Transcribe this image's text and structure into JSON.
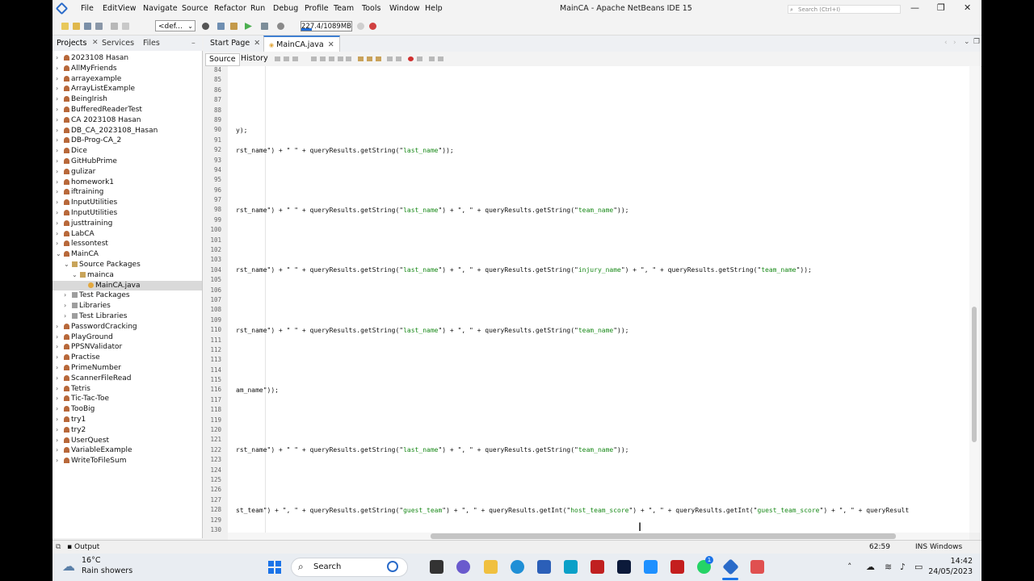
{
  "window": {
    "title": "MainCA - Apache NetBeans IDE 15",
    "search_placeholder": "Search (Ctrl+I)"
  },
  "menu": [
    "File",
    "Edit",
    "View",
    "Navigate",
    "Source",
    "Refactor",
    "Run",
    "Debug",
    "Profile",
    "Team",
    "Tools",
    "Window",
    "Help"
  ],
  "toolbar": {
    "config": "<def...",
    "memory": "227.4/1089MB",
    "memory_fraction": 0.209
  },
  "projects_panel": {
    "tabs": [
      "Projects",
      "Services",
      "Files"
    ],
    "items": [
      {
        "label": "2023108 Hasan",
        "depth": 0,
        "icon": "project-icon"
      },
      {
        "label": "AllMyFriends",
        "depth": 0,
        "icon": "project-icon"
      },
      {
        "label": "arrayexample",
        "depth": 0,
        "icon": "project-icon"
      },
      {
        "label": "ArrayListExample",
        "depth": 0,
        "icon": "project-icon"
      },
      {
        "label": "BeingIrish",
        "depth": 0,
        "icon": "project-icon"
      },
      {
        "label": "BufferedReaderTest",
        "depth": 0,
        "icon": "project-icon"
      },
      {
        "label": "CA 2023108 Hasan",
        "depth": 0,
        "icon": "project-icon"
      },
      {
        "label": "DB_CA_2023108_Hasan",
        "depth": 0,
        "icon": "project-icon"
      },
      {
        "label": "DB-Prog-CA_2",
        "depth": 0,
        "icon": "project-icon"
      },
      {
        "label": "Dice",
        "depth": 0,
        "icon": "project-icon"
      },
      {
        "label": "GitHubPrime",
        "depth": 0,
        "icon": "project-icon"
      },
      {
        "label": "gulizar",
        "depth": 0,
        "icon": "project-icon"
      },
      {
        "label": "homework1",
        "depth": 0,
        "icon": "project-icon"
      },
      {
        "label": "iftraining",
        "depth": 0,
        "icon": "project-icon"
      },
      {
        "label": "InputUtilities",
        "depth": 0,
        "icon": "project-icon"
      },
      {
        "label": "InputUtilities",
        "depth": 0,
        "icon": "project-icon"
      },
      {
        "label": "justtraining",
        "depth": 0,
        "icon": "project-icon"
      },
      {
        "label": "LabCA",
        "depth": 0,
        "icon": "project-icon"
      },
      {
        "label": "lessontest",
        "depth": 0,
        "icon": "project-icon"
      },
      {
        "label": "MainCA",
        "depth": 0,
        "icon": "project-icon",
        "expanded": true
      },
      {
        "label": "Source Packages",
        "depth": 1,
        "icon": "source-packages-icon",
        "expanded": true
      },
      {
        "label": "mainca",
        "depth": 2,
        "icon": "package-icon",
        "expanded": true
      },
      {
        "label": "MainCA.java",
        "depth": 3,
        "icon": "java-file-icon",
        "selected": true
      },
      {
        "label": "Test Packages",
        "depth": 1,
        "icon": "folder-icon"
      },
      {
        "label": "Libraries",
        "depth": 1,
        "icon": "folder-icon"
      },
      {
        "label": "Test Libraries",
        "depth": 1,
        "icon": "folder-icon"
      },
      {
        "label": "PasswordCracking",
        "depth": 0,
        "icon": "project-icon"
      },
      {
        "label": "PlayGround",
        "depth": 0,
        "icon": "project-icon"
      },
      {
        "label": "PPSNValidator",
        "depth": 0,
        "icon": "project-icon"
      },
      {
        "label": "Practise",
        "depth": 0,
        "icon": "project-icon"
      },
      {
        "label": "PrimeNumber",
        "depth": 0,
        "icon": "project-icon"
      },
      {
        "label": "ScannerFileRead",
        "depth": 0,
        "icon": "project-icon"
      },
      {
        "label": "Tetris",
        "depth": 0,
        "icon": "project-icon"
      },
      {
        "label": "Tic-Tac-Toe",
        "depth": 0,
        "icon": "project-icon"
      },
      {
        "label": "TooBig",
        "depth": 0,
        "icon": "project-icon"
      },
      {
        "label": "try1",
        "depth": 0,
        "icon": "project-icon"
      },
      {
        "label": "try2",
        "depth": 0,
        "icon": "project-icon"
      },
      {
        "label": "UserQuest",
        "depth": 0,
        "icon": "project-icon"
      },
      {
        "label": "VariableExample",
        "depth": 0,
        "icon": "project-icon"
      },
      {
        "label": "WriteToFileSum",
        "depth": 0,
        "icon": "project-icon"
      }
    ]
  },
  "editor": {
    "tabs": [
      {
        "label": "Start Page",
        "active": false
      },
      {
        "label": "MainCA.java",
        "active": true
      }
    ],
    "views": [
      "Source",
      "History"
    ],
    "first_line": 84,
    "line_count": 47,
    "code_lines": {
      "90": [
        [
          "p",
          "y);"
        ]
      ],
      "92": [
        [
          "p",
          "rst_name\") + \" \" + queryResults.getString(\""
        ],
        [
          "s",
          "last_name"
        ],
        [
          "p",
          "\"));"
        ]
      ],
      "98": [
        [
          "p",
          "rst_name\") + \" \" + queryResults.getString(\""
        ],
        [
          "s",
          "last_name"
        ],
        [
          "p",
          "\") + \", \" + queryResults.getString(\""
        ],
        [
          "s",
          "team_name"
        ],
        [
          "p",
          "\"));"
        ]
      ],
      "104": [
        [
          "p",
          "rst_name\") + \" \" + queryResults.getString(\""
        ],
        [
          "s",
          "last_name"
        ],
        [
          "p",
          "\") + \", \" + queryResults.getString(\""
        ],
        [
          "s",
          "injury_name"
        ],
        [
          "p",
          "\") + \", \" + queryResults.getString(\""
        ],
        [
          "s",
          "team_name"
        ],
        [
          "p",
          "\"));"
        ]
      ],
      "110": [
        [
          "p",
          "rst_name\") + \" \" + queryResults.getString(\""
        ],
        [
          "s",
          "last_name"
        ],
        [
          "p",
          "\") + \", \" + queryResults.getString(\""
        ],
        [
          "s",
          "team_name"
        ],
        [
          "p",
          "\"));"
        ]
      ],
      "116": [
        [
          "p",
          "am_name\"));"
        ]
      ],
      "122": [
        [
          "p",
          "rst_name\") + \" \" + queryResults.getString(\""
        ],
        [
          "s",
          "last_name"
        ],
        [
          "p",
          "\") + \", \" + queryResults.getString(\""
        ],
        [
          "s",
          "team_name"
        ],
        [
          "p",
          "\"));"
        ]
      ],
      "128": [
        [
          "p",
          "st_team\") + \", \" + queryResults.getString(\""
        ],
        [
          "s",
          "guest_team"
        ],
        [
          "p",
          "\") + \", \" + queryResults.getInt(\""
        ],
        [
          "s",
          "host_team_score"
        ],
        [
          "p",
          "\") + \", \" + queryResults.getInt(\""
        ],
        [
          "s",
          "guest_team_score"
        ],
        [
          "p",
          "\") + \", \" + queryResult"
        ]
      ]
    }
  },
  "statusbar": {
    "output_label": "Output",
    "position": "62:59",
    "mode": "INS Windows (CRLF)"
  },
  "taskbar": {
    "weather_temp": "16°C",
    "weather_desc": "Rain showers",
    "search_label": "Search",
    "time": "14:42",
    "date": "24/05/2023",
    "whatsapp_badge": "1"
  },
  "colors": {
    "accent": "#3f7fd1",
    "string": "#1a8a1a",
    "memory_bar": "#1e6bd6"
  }
}
